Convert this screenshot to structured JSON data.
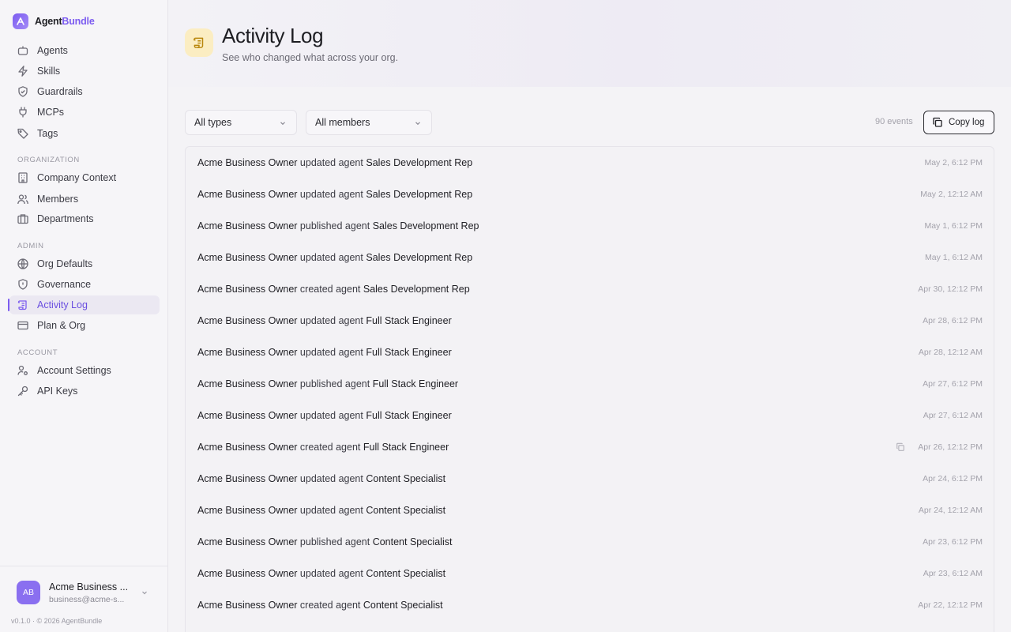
{
  "brand": {
    "name_part1": "Agent",
    "name_part2": "Bundle"
  },
  "sidebar": {
    "main_items": [
      {
        "label": "Agents",
        "icon": "bot-icon"
      },
      {
        "label": "Skills",
        "icon": "zap-icon"
      },
      {
        "label": "Guardrails",
        "icon": "shield-check-icon"
      },
      {
        "label": "MCPs",
        "icon": "plug-icon"
      },
      {
        "label": "Tags",
        "icon": "tag-icon"
      }
    ],
    "organization_label": "ORGANIZATION",
    "organization_items": [
      {
        "label": "Company Context",
        "icon": "building-icon"
      },
      {
        "label": "Members",
        "icon": "users-icon"
      },
      {
        "label": "Departments",
        "icon": "briefcase-icon"
      }
    ],
    "admin_label": "ADMIN",
    "admin_items": [
      {
        "label": "Org Defaults",
        "icon": "globe-icon"
      },
      {
        "label": "Governance",
        "icon": "shield-icon"
      },
      {
        "label": "Activity Log",
        "icon": "scroll-icon",
        "active": true
      },
      {
        "label": "Plan & Org",
        "icon": "credit-card-icon"
      }
    ],
    "account_label": "ACCOUNT",
    "account_items": [
      {
        "label": "Account Settings",
        "icon": "user-cog-icon"
      },
      {
        "label": "API Keys",
        "icon": "key-icon"
      }
    ],
    "user": {
      "initials": "AB",
      "name": "Acme Business ...",
      "email": "business@acme-s..."
    },
    "version": "v0.1.0 · © 2026 AgentBundle"
  },
  "header": {
    "title": "Activity Log",
    "subtitle": "See who changed what across your org."
  },
  "filters": {
    "type_value": "All types",
    "member_value": "All members",
    "events_count": "90 events",
    "copy_label": "Copy log"
  },
  "log": [
    {
      "actor": "Acme Business Owner",
      "action": "updated agent",
      "target": "Sales Development Rep",
      "time": "May 2, 6:12 PM"
    },
    {
      "actor": "Acme Business Owner",
      "action": "updated agent",
      "target": "Sales Development Rep",
      "time": "May 2, 12:12 AM"
    },
    {
      "actor": "Acme Business Owner",
      "action": "published agent",
      "target": "Sales Development Rep",
      "time": "May 1, 6:12 PM"
    },
    {
      "actor": "Acme Business Owner",
      "action": "updated agent",
      "target": "Sales Development Rep",
      "time": "May 1, 6:12 AM"
    },
    {
      "actor": "Acme Business Owner",
      "action": "created agent",
      "target": "Sales Development Rep",
      "time": "Apr 30, 12:12 PM"
    },
    {
      "actor": "Acme Business Owner",
      "action": "updated agent",
      "target": "Full Stack Engineer",
      "time": "Apr 28, 6:12 PM"
    },
    {
      "actor": "Acme Business Owner",
      "action": "updated agent",
      "target": "Full Stack Engineer",
      "time": "Apr 28, 12:12 AM"
    },
    {
      "actor": "Acme Business Owner",
      "action": "published agent",
      "target": "Full Stack Engineer",
      "time": "Apr 27, 6:12 PM"
    },
    {
      "actor": "Acme Business Owner",
      "action": "updated agent",
      "target": "Full Stack Engineer",
      "time": "Apr 27, 6:12 AM"
    },
    {
      "actor": "Acme Business Owner",
      "action": "created agent",
      "target": "Full Stack Engineer",
      "time": "Apr 26, 12:12 PM",
      "hover_copy": true
    },
    {
      "actor": "Acme Business Owner",
      "action": "updated agent",
      "target": "Content Specialist",
      "time": "Apr 24, 6:12 PM"
    },
    {
      "actor": "Acme Business Owner",
      "action": "updated agent",
      "target": "Content Specialist",
      "time": "Apr 24, 12:12 AM"
    },
    {
      "actor": "Acme Business Owner",
      "action": "published agent",
      "target": "Content Specialist",
      "time": "Apr 23, 6:12 PM"
    },
    {
      "actor": "Acme Business Owner",
      "action": "updated agent",
      "target": "Content Specialist",
      "time": "Apr 23, 6:12 AM"
    },
    {
      "actor": "Acme Business Owner",
      "action": "created agent",
      "target": "Content Specialist",
      "time": "Apr 22, 12:12 PM"
    }
  ],
  "colors": {
    "accent": "#7c5cf0",
    "page_icon_bg": "#fbedc2"
  }
}
